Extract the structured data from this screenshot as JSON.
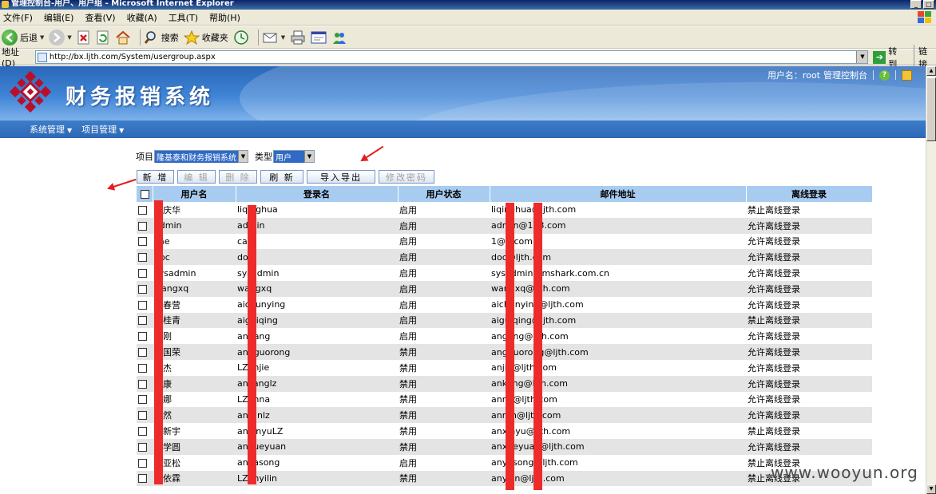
{
  "window": {
    "title": "管理控制台-用户、用户组 - Microsoft Internet Explorer"
  },
  "menu": [
    "文件(F)",
    "编辑(E)",
    "查看(V)",
    "收藏(A)",
    "工具(T)",
    "帮助(H)"
  ],
  "toolbar": {
    "back": "后退",
    "search": "搜索",
    "favorites": "收藏夹"
  },
  "address": {
    "label": "地址(D)",
    "url": "http://bx.ljth.com/System/usergroup.aspx",
    "go": "转到",
    "links": "链接"
  },
  "app": {
    "title": "财务报销系统",
    "user_label": "用户名：root",
    "console_link": "管理控制台"
  },
  "nav": [
    "系统管理",
    "项目管理"
  ],
  "filters": {
    "project_label": "项目",
    "project_value": "隆基泰和财务报销系统",
    "type_label": "类型",
    "type_value": "用户"
  },
  "actions": {
    "add": "新 增",
    "edit": "编 辑",
    "delete": "删 除",
    "refresh": "刷 新",
    "import_export": "导入导出",
    "change_password": "修改密码"
  },
  "table": {
    "columns": [
      "用户名",
      "登录名",
      "用户状态",
      "邮件地址",
      "离线登录"
    ],
    "rows": [
      [
        "李庆华",
        "liqinghua",
        "启用",
        "liqinghua@ljth.com",
        "禁止离线登录"
      ],
      [
        "admin",
        "admin",
        "启用",
        "admin@163.com",
        "允许离线登录"
      ],
      [
        "cae",
        "cai",
        "启用",
        "1@1.com",
        "允许离线登录"
      ],
      [
        "doc",
        "doc",
        "启用",
        "doc@ljth.com",
        "允许离线登录"
      ],
      [
        "sysadmin",
        "sysadmin",
        "启用",
        "sysadmin@mshark.com.cn",
        "允许离线登录"
      ],
      [
        "wangxq",
        "wangxq",
        "启用",
        "wangxq@ljth.com",
        "允许离线登录"
      ],
      [
        "艾春营",
        "aichunying",
        "启用",
        "aichunying@ljth.com",
        "允许离线登录"
      ],
      [
        "艾桂青",
        "aiguiqing",
        "启用",
        "aiguiqing@ljth.com",
        "禁止离线登录"
      ],
      [
        "安刚",
        "angang",
        "启用",
        "angang@ljth.com",
        "允许离线登录"
      ],
      [
        "安国荣",
        "angguorong",
        "禁用",
        "angguorong@ljth.com",
        "允许离线登录"
      ],
      [
        "安杰",
        "LZanjie",
        "禁用",
        "anjie@ljth.com",
        "允许离线登录"
      ],
      [
        "安康",
        "ankanglz",
        "禁用",
        "ankang@ljth.com",
        "允许离线登录"
      ],
      [
        "安娜",
        "LZanna",
        "禁用",
        "anna@ljth.com",
        "允许离线登录"
      ],
      [
        "安然",
        "anranlz",
        "禁用",
        "anran@ljth.com",
        "允许离线登录"
      ],
      [
        "安新宇",
        "anxinyuLZ",
        "禁用",
        "anxinyu@ljth.com",
        "禁止离线登录"
      ],
      [
        "安学圆",
        "anxueyuan",
        "禁用",
        "anxueyuan@ljth.com",
        "允许离线登录"
      ],
      [
        "安亚松",
        "anyasong",
        "启用",
        "anyasong@ljth.com",
        "禁止离线登录"
      ],
      [
        "安依霖",
        "LZanyilin",
        "禁用",
        "anyilin@ljth.com",
        "禁止离线登录"
      ]
    ]
  },
  "watermark": "www.wooyun.org"
}
